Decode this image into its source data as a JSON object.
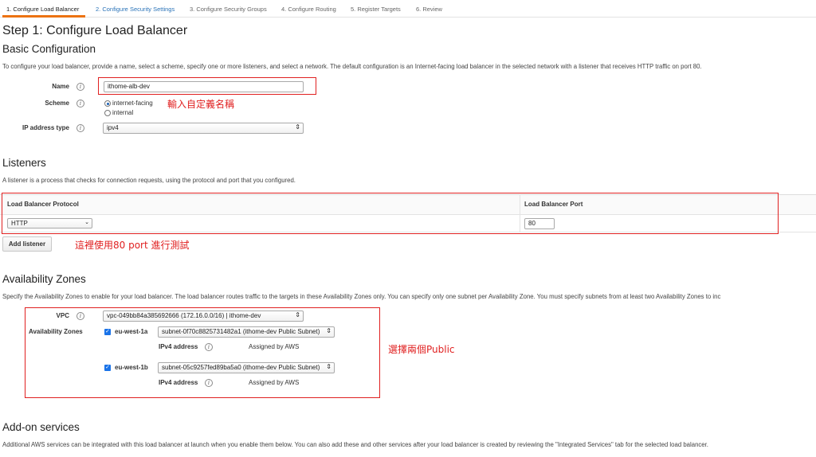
{
  "wizard": {
    "steps": [
      "1. Configure Load Balancer",
      "2. Configure Security Settings",
      "3. Configure Security Groups",
      "4. Configure Routing",
      "5. Register Targets",
      "6. Review"
    ],
    "active_color": "#ec7211"
  },
  "page_title": "Step 1: Configure Load Balancer",
  "basic": {
    "heading": "Basic Configuration",
    "description": "To configure your load balancer, provide a name, select a scheme, specify one or more listeners, and select a network. The default configuration is an Internet-facing load balancer in the selected network with a listener that receives HTTP traffic on port 80.",
    "name_label": "Name",
    "name_value": "ithome-alb-dev",
    "scheme_label": "Scheme",
    "scheme_options": [
      "internet-facing",
      "internal"
    ],
    "scheme_selected": "internet-facing",
    "ip_label": "IP address type",
    "ip_value": "ipv4",
    "annotation": "輸入自定義名稱"
  },
  "listeners": {
    "heading": "Listeners",
    "description": "A listener is a process that checks for connection requests, using the protocol and port that you configured.",
    "col_protocol": "Load Balancer Protocol",
    "col_port": "Load Balancer Port",
    "protocol_value": "HTTP",
    "port_value": "80",
    "add_button": "Add listener",
    "annotation": "這裡使用80 port 進行測試"
  },
  "az": {
    "heading": "Availability Zones",
    "description": "Specify the Availability Zones to enable for your load balancer. The load balancer routes traffic to the targets in these Availability Zones only. You can specify only one subnet per Availability Zone. You must specify subnets from at least two Availability Zones to inc",
    "vpc_label": "VPC",
    "vpc_value": "vpc-049bb84a385692666 (172.16.0.0/16) | ithome-dev",
    "zones_label": "Availability Zones",
    "zones": [
      {
        "name": "eu-west-1a",
        "subnet": "subnet-0f70c8825731482a1 (ithome-dev Public Subnet)",
        "ipv4_label": "IPv4 address",
        "ipv4_value": "Assigned by AWS"
      },
      {
        "name": "eu-west-1b",
        "subnet": "subnet-05c9257fed89ba5a0 (ithome-dev Public Subnet)",
        "ipv4_label": "IPv4 address",
        "ipv4_value": "Assigned by AWS"
      }
    ],
    "annotation": "選擇兩個Public"
  },
  "addon": {
    "heading": "Add-on services",
    "description": "Additional AWS services can be integrated with this load balancer at launch when you enable them below. You can also add these and other services after your load balancer is created by reviewing the \"Integrated Services\" tab for the selected load balancer."
  },
  "icons": {
    "info": "info-icon",
    "dropdown": "dropdown-arrow-icon",
    "check": "checkbox-checked-icon"
  },
  "colors": {
    "annotation_red": "#e02020",
    "link_blue": "#2a73b8",
    "checkbox_blue": "#1a73e8"
  }
}
